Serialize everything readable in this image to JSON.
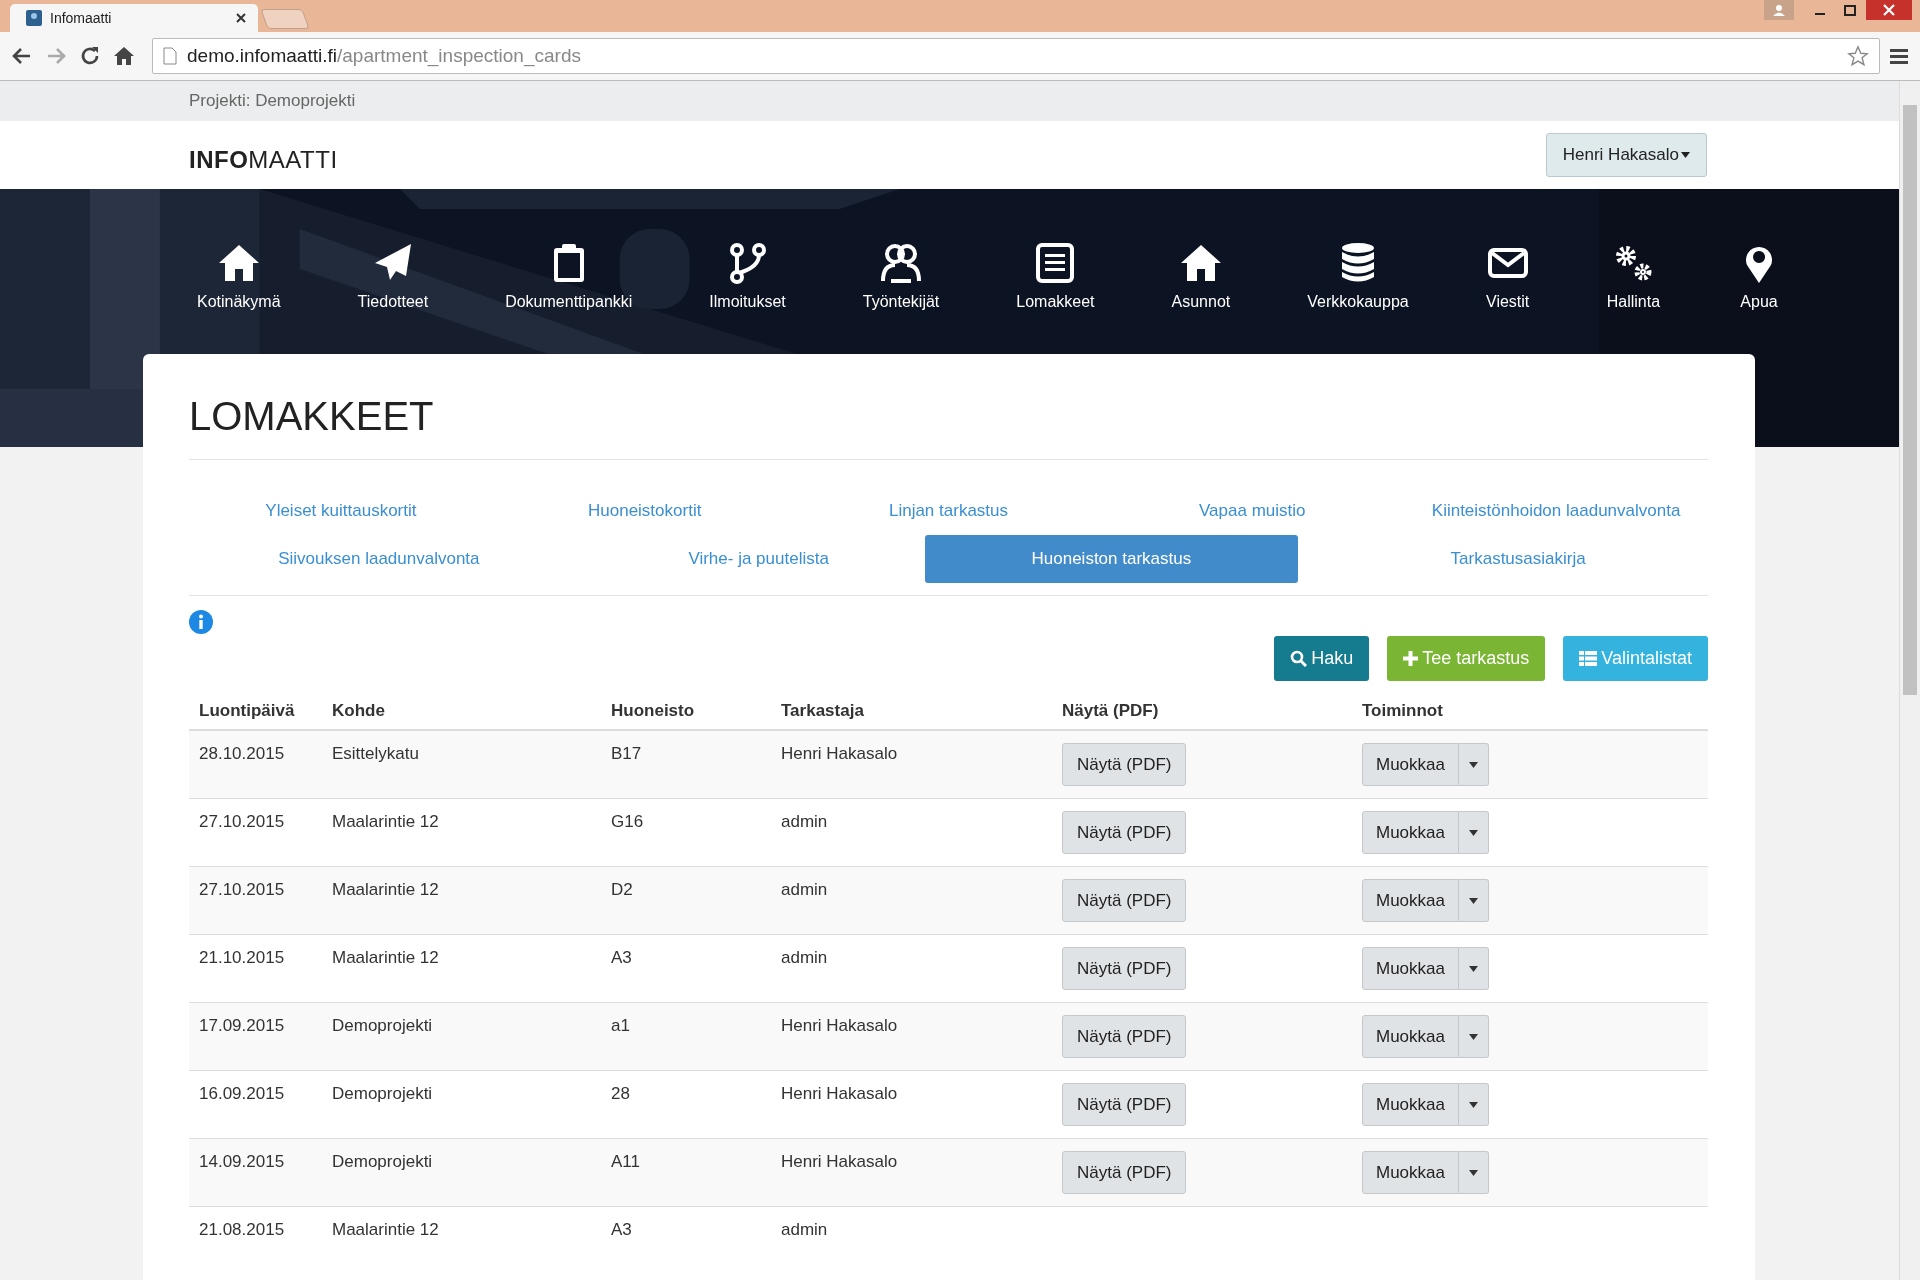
{
  "browser": {
    "tab_title": "Infomaatti",
    "url_host": "demo.infomaatti.fi",
    "url_path": "/apartment_inspection_cards"
  },
  "project_label": "Projekti: Demoprojekti",
  "logo": {
    "bold": "INFO",
    "rest": "MAATTI"
  },
  "user_menu": "Henri Hakasalo",
  "nav": [
    {
      "label": "Kotinäkymä"
    },
    {
      "label": "Tiedotteet"
    },
    {
      "label": "Dokumenttipankki"
    },
    {
      "label": "Ilmoitukset"
    },
    {
      "label": "Työntekijät"
    },
    {
      "label": "Lomakkeet"
    },
    {
      "label": "Asunnot"
    },
    {
      "label": "Verkkokauppa"
    },
    {
      "label": "Viestit"
    },
    {
      "label": "Hallinta"
    },
    {
      "label": "Apua"
    }
  ],
  "page_title": "LOMAKKEET",
  "tab_rows": [
    [
      {
        "label": "Yleiset kuittauskortit",
        "selected": false
      },
      {
        "label": "Huoneistokortit",
        "selected": false
      },
      {
        "label": "Linjan tarkastus",
        "selected": false
      },
      {
        "label": "Vapaa muistio",
        "selected": false
      },
      {
        "label": "Kiinteistönhoidon laadunvalvonta",
        "selected": false
      }
    ],
    [
      {
        "label": "Siivouksen laadunvalvonta",
        "selected": false
      },
      {
        "label": "Virhe- ja puutelista",
        "selected": false
      },
      {
        "label": "Huoneiston tarkastus",
        "selected": true
      },
      {
        "label": "Tarkastusasiakirja",
        "selected": false
      }
    ]
  ],
  "actions": [
    {
      "kind": "search",
      "label": "Haku"
    },
    {
      "kind": "add",
      "label": "Tee tarkastus"
    },
    {
      "kind": "lists",
      "label": "Valintalistat"
    }
  ],
  "table": {
    "columns": [
      "Luontipäivä",
      "Kohde",
      "Huoneisto",
      "Tarkastaja",
      "Näytä (PDF)",
      "Toiminnot"
    ],
    "rows": [
      {
        "date": "28.10.2015",
        "target": "Esittelykatu",
        "apartment": "B17",
        "inspector": "Henri Hakasalo",
        "pdf": "Näytä (PDF)",
        "edit": "Muokkaa"
      },
      {
        "date": "27.10.2015",
        "target": "Maalarintie 12",
        "apartment": "G16",
        "inspector": "admin",
        "pdf": "Näytä (PDF)",
        "edit": "Muokkaa"
      },
      {
        "date": "27.10.2015",
        "target": "Maalarintie 12",
        "apartment": "D2",
        "inspector": "admin",
        "pdf": "Näytä (PDF)",
        "edit": "Muokkaa"
      },
      {
        "date": "21.10.2015",
        "target": "Maalarintie 12",
        "apartment": "A3",
        "inspector": "admin",
        "pdf": "Näytä (PDF)",
        "edit": "Muokkaa"
      },
      {
        "date": "17.09.2015",
        "target": "Demoprojekti",
        "apartment": "a1",
        "inspector": "Henri Hakasalo",
        "pdf": "Näytä (PDF)",
        "edit": "Muokkaa"
      },
      {
        "date": "16.09.2015",
        "target": "Demoprojekti",
        "apartment": "28",
        "inspector": "Henri Hakasalo",
        "pdf": "Näytä (PDF)",
        "edit": "Muokkaa"
      },
      {
        "date": "14.09.2015",
        "target": "Demoprojekti",
        "apartment": "A11",
        "inspector": "Henri Hakasalo",
        "pdf": "Näytä (PDF)",
        "edit": "Muokkaa"
      },
      {
        "date": "21.08.2015",
        "target": "Maalarintie 12",
        "apartment": "A3",
        "inspector": "admin"
      }
    ]
  }
}
